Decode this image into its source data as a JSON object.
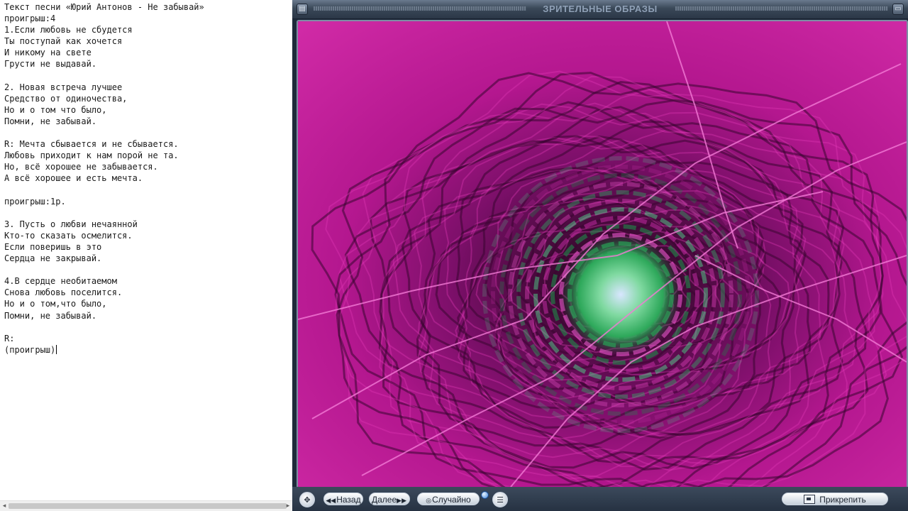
{
  "editor": {
    "lines": [
      "Текст песни «Юрий Антонов - Не забывай»",
      "проигрыш:4",
      "1.Если любовь не сбудется",
      "Ты поступай как хочется",
      "И никому на свете",
      "Грусти не выдавай.",
      "",
      "2. Новая встреча лучшее",
      "Средство от одиночества,",
      "Но и о том что было,",
      "Помни, не забывай.",
      "",
      "R: Мечта сбывается и не сбывается.",
      "Любовь приходит к нам порой не та.",
      "Но, всё хорошее не забывается.",
      "А всё хорошее и есть мечта.",
      "",
      "проигрыш:1р.",
      "",
      "3. Пусть о любви нечаянной",
      "Кто-то сказать осмелится.",
      "Если поверишь в это",
      "Сердца не закрывай.",
      "",
      "4.В сердце необитаемом",
      "Снова любовь поселится.",
      "Но и о том,что было,",
      "Помни, не забывай.",
      "",
      "R:",
      "(проигрыш)"
    ]
  },
  "player": {
    "title": "ЗРИТЕЛЬНЫЕ ОБРАЗЫ",
    "controls": {
      "back_label": "Назад",
      "next_label": "Далее",
      "random_label": "Случайно",
      "attach_label": "Прикрепить"
    },
    "icons": {
      "menu": "app-menu-icon",
      "minimize": "minimize-icon",
      "navigate": "navigate-icon",
      "list": "list-icon"
    },
    "colors": {
      "viz_magenta": "#c2189f",
      "viz_green": "#3ec86a",
      "frame": "#7d8ea4",
      "chrome": "#2b3747"
    }
  }
}
